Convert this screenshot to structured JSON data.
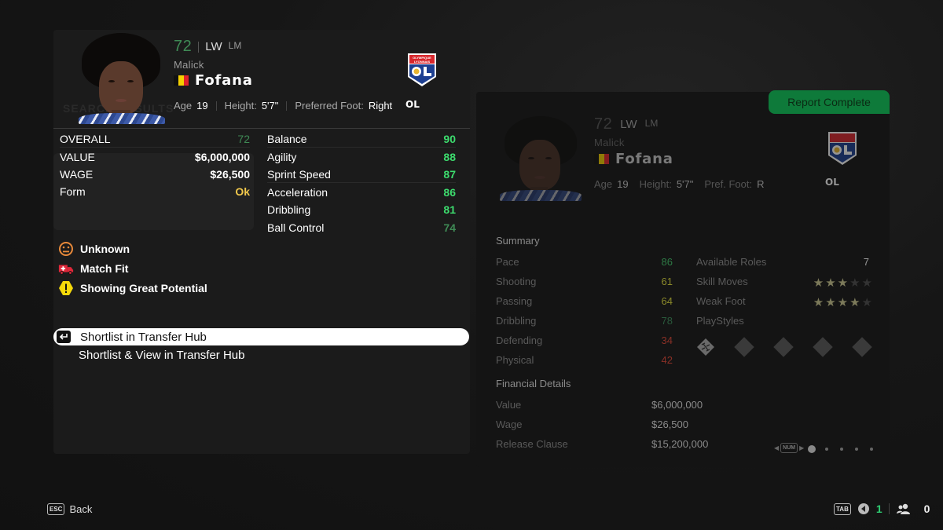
{
  "player": {
    "rating": "72",
    "primary_position": "LW",
    "secondary_position": "LM",
    "first_name": "Malick",
    "last_name": "Fofana",
    "nationality_flag": "belgium-flag",
    "flag_colors": [
      "#111111",
      "#f5d000",
      "#e0232a"
    ],
    "age_label": "Age",
    "age": "19",
    "height_label": "Height:",
    "height": "5'7\"",
    "foot_label": "Preferred Foot:",
    "foot": "Right",
    "club_abbr": "OL",
    "club_crest": "olympique-lyonnais-crest",
    "club_crest_text": "OLYMPIQUE LYONNAIS",
    "club_crest_mono": "OL"
  },
  "overview": [
    {
      "label": "OVERALL",
      "value": "72",
      "color": "#3f8a55"
    },
    {
      "label": "VALUE",
      "value": "$6,000,000",
      "color": "#ffffff"
    },
    {
      "label": "WAGE",
      "value": "$26,500",
      "color": "#ffffff"
    },
    {
      "label": "Form",
      "value": "Ok",
      "color": "#f2c94c"
    }
  ],
  "attributes": [
    {
      "label": "Balance",
      "value": "90",
      "color": "#3ddc6e"
    },
    {
      "label": "Agility",
      "value": "88",
      "color": "#3ddc6e"
    },
    {
      "label": "Sprint Speed",
      "value": "87",
      "color": "#3ddc6e"
    },
    {
      "label": "Acceleration",
      "value": "86",
      "color": "#3ddc6e"
    },
    {
      "label": "Dribbling",
      "value": "81",
      "color": "#3ddc6e"
    },
    {
      "label": "Ball Control",
      "value": "74",
      "color": "#3f8a55"
    }
  ],
  "status": [
    {
      "icon": "neutral-face-icon",
      "label": "Unknown",
      "color": "#e8893a"
    },
    {
      "icon": "ambulance-icon",
      "label": "Match Fit",
      "color": "#e0283a"
    },
    {
      "icon": "warning-icon",
      "label": "Showing Great Potential",
      "color": "#f5d90a"
    }
  ],
  "menu": [
    {
      "label": "Shortlist in Transfer Hub",
      "selected": true
    },
    {
      "label": "Shortlist & View in Transfer Hub",
      "selected": false
    }
  ],
  "report": {
    "badge": "Report Complete",
    "badge_color": "#0e7a3a",
    "rating": "72",
    "primary_position": "LW",
    "secondary_position": "LM",
    "first_name": "Malick",
    "last_name": "Fofana",
    "age_label": "Age",
    "age": "19",
    "height_label": "Height:",
    "height": "5'7\"",
    "foot_label": "Pref. Foot:",
    "foot": "R",
    "club_abbr": "OL",
    "summary_title": "Summary",
    "summary": [
      {
        "label": "Pace",
        "value": "86",
        "color": "#2e7a45"
      },
      {
        "label": "Shooting",
        "value": "61",
        "color": "#8c8a2a"
      },
      {
        "label": "Passing",
        "value": "64",
        "color": "#8c8a2a"
      },
      {
        "label": "Dribbling",
        "value": "78",
        "color": "#2a5a3c"
      },
      {
        "label": "Defending",
        "value": "34",
        "color": "#8a3026"
      },
      {
        "label": "Physical",
        "value": "42",
        "color": "#8a3026"
      }
    ],
    "roles_label": "Available Roles",
    "roles_value": "7",
    "skill_moves_label": "Skill Moves",
    "skill_moves": 3,
    "weak_foot_label": "Weak Foot",
    "weak_foot": 4,
    "stars_max": 5,
    "playstyles_label": "PlayStyles",
    "playstyles": [
      "technical-playstyle-icon",
      "empty-slot",
      "empty-slot",
      "empty-slot",
      "empty-slot"
    ],
    "financial_title": "Financial Details",
    "financial": [
      {
        "label": "Value",
        "value": "$6,000,000"
      },
      {
        "label": "Wage",
        "value": "$26,500"
      },
      {
        "label": "Release Clause",
        "value": "$15,200,000"
      }
    ],
    "pager_key": "NUM",
    "pager_pages": 5,
    "pager_current": 1
  },
  "footer": {
    "back_key": "ESC",
    "back_label": "Back",
    "tab_key": "TAB",
    "notifications_count": "1",
    "users_count": "0"
  },
  "ghost_text": {
    "search_results": "SEARCH RESULTS"
  }
}
